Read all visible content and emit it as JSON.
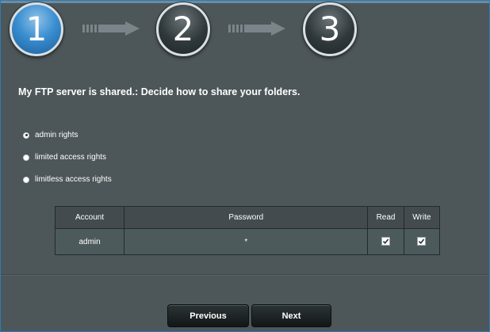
{
  "wizard": {
    "steps": [
      {
        "number": "1",
        "state": "active"
      },
      {
        "number": "2",
        "state": "inactive"
      },
      {
        "number": "3",
        "state": "inactive"
      }
    ]
  },
  "title": "My FTP server is shared.: Decide how to share your folders.",
  "options": [
    {
      "label": "admin rights",
      "selected": true
    },
    {
      "label": "limited access rights",
      "selected": false
    },
    {
      "label": "limitless access rights",
      "selected": false
    }
  ],
  "table": {
    "headers": {
      "account": "Account",
      "password": "Password",
      "read": "Read",
      "write": "Write"
    },
    "rows": [
      {
        "account": "admin",
        "password": "*",
        "read": true,
        "write": true
      }
    ]
  },
  "buttons": {
    "previous": "Previous",
    "next": "Next"
  },
  "colors": {
    "background": "#4d5659",
    "active_step": "#3b8fd1",
    "frame_border": "#2b7bb5"
  }
}
